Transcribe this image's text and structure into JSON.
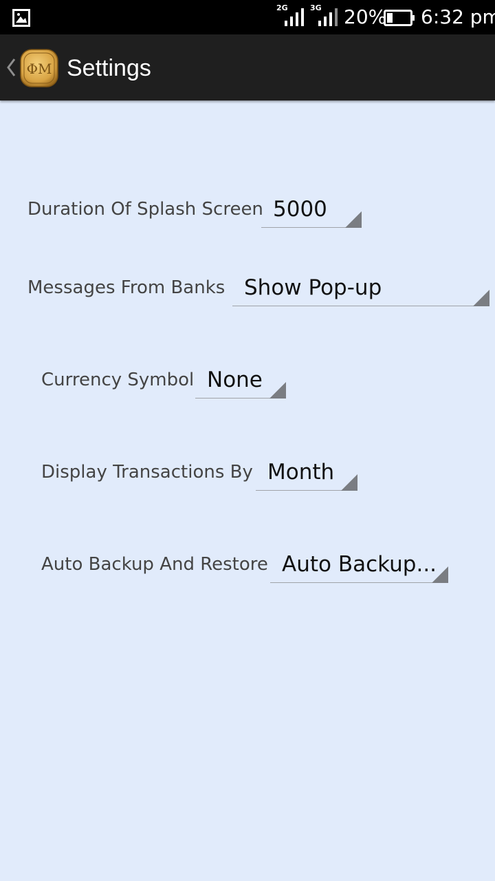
{
  "status_bar": {
    "network1": "2G",
    "network2": "3G",
    "battery_percent": "20%",
    "time": "6:32 pm",
    "icons": [
      "gallery-icon",
      "signal-icon",
      "battery-icon"
    ]
  },
  "action_bar": {
    "title": "Settings",
    "logo_text": "ΦM",
    "icons": [
      "back-chevron-icon",
      "app-logo-icon"
    ]
  },
  "settings": [
    {
      "label": "Duration Of Splash Screen",
      "value": "5000"
    },
    {
      "label": "Messages From Banks",
      "value": "Show Pop-up"
    },
    {
      "label": "Currency Symbol",
      "value": "None"
    },
    {
      "label": "Display Transactions By",
      "value": "Month"
    },
    {
      "label": "Auto Backup And Restore",
      "value": "Auto Backup..."
    }
  ],
  "colors": {
    "background": "#e1ebfb",
    "status_bar": "#000000",
    "action_bar": "#1f1f1f",
    "label_text": "#444444",
    "value_text": "#111111",
    "spinner_arrow": "#7a7d82",
    "logo_gold": "#d9a444"
  }
}
